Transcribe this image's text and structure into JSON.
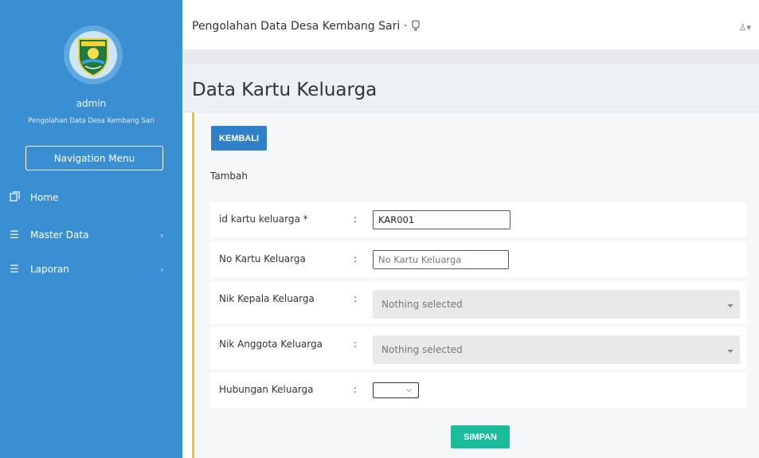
{
  "sidebar": {
    "user": "admin",
    "subtitle": "Pengolahan Data Desa Kembang Sari",
    "nav_button": "Navigation Menu",
    "items": [
      {
        "label": "Home",
        "icon": "home-icon",
        "has_submenu": false
      },
      {
        "label": "Master Data",
        "icon": "list-icon",
        "has_submenu": true
      },
      {
        "label": "Laporan",
        "icon": "list-icon",
        "has_submenu": true
      }
    ],
    "submenu_chevron": "›"
  },
  "topbar": {
    "title": "Pengolahan Data Desa Kembang Sari · ",
    "user_menu": "♙▾"
  },
  "page": {
    "title": "Data Kartu Keluarga",
    "back_button": "KEMBALI",
    "subtitle": "Tambah",
    "save_button": "SIMPAN"
  },
  "form": {
    "colon": ":",
    "id_label": "id kartu keluarga *",
    "id_value": "KAR001",
    "nokk_label": "No Kartu Keluarga",
    "nokk_placeholder": "No Kartu Keluarga",
    "nik_kepala_label": "Nik Kepala Keluarga",
    "nik_kepala_value": "Nothing selected",
    "nik_anggota_label": "Nik Anggota Keluarga",
    "nik_anggota_value": "Nothing selected",
    "hubungan_label": "Hubungan Keluarga",
    "hubungan_value": ""
  },
  "colors": {
    "sidebar": "#3a8fd3",
    "accent_border": "#f5c518",
    "primary_button": "#2f80c9",
    "save_button": "#1abc9c"
  }
}
